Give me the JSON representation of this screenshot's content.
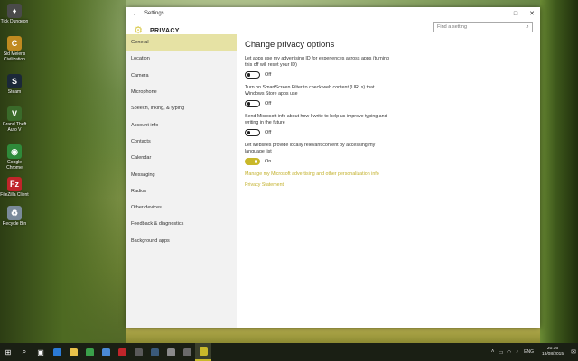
{
  "desktop": {
    "icons": [
      {
        "label": "Recycle Bin",
        "icon": "recycle-bin-icon",
        "color": "#7a8a9a",
        "glyph": "♻"
      },
      {
        "label": "FileZilla Client",
        "icon": "filezilla-icon",
        "color": "#c0252a",
        "glyph": "Fz"
      },
      {
        "label": "Google Chrome",
        "icon": "chrome-icon",
        "color": "#2f8a3a",
        "glyph": "◉"
      },
      {
        "label": "Grand Theft Auto V",
        "icon": "gta-icon",
        "color": "#3a6a2a",
        "glyph": "V"
      },
      {
        "label": "Steam",
        "icon": "steam-icon",
        "color": "#1b2838",
        "glyph": "S"
      },
      {
        "label": "Sid Meier's Civilization",
        "icon": "civ-icon",
        "color": "#c08a20",
        "glyph": "C"
      },
      {
        "label": "Tick Dungeon",
        "icon": "game-icon",
        "color": "#4a4a4a",
        "glyph": "♦"
      }
    ]
  },
  "window": {
    "title": "Settings",
    "back": "←",
    "minimize": "—",
    "maximize": "□",
    "close": "✕",
    "section": "PRIVACY",
    "search_placeholder": "Find a setting",
    "search_icon": "⌕"
  },
  "sidebar": {
    "items": [
      {
        "label": "General",
        "active": true
      },
      {
        "label": "Location",
        "active": false
      },
      {
        "label": "Camera",
        "active": false
      },
      {
        "label": "Microphone",
        "active": false
      },
      {
        "label": "Speech, inking, & typing",
        "active": false
      },
      {
        "label": "Account info",
        "active": false
      },
      {
        "label": "Contacts",
        "active": false
      },
      {
        "label": "Calendar",
        "active": false
      },
      {
        "label": "Messaging",
        "active": false
      },
      {
        "label": "Radios",
        "active": false
      },
      {
        "label": "Other devices",
        "active": false
      },
      {
        "label": "Feedback & diagnostics",
        "active": false
      },
      {
        "label": "Background apps",
        "active": false
      }
    ]
  },
  "content": {
    "title": "Change privacy options",
    "options": [
      {
        "text": "Let apps use my advertising ID for experiences across apps (turning this off will reset your ID)",
        "state": "Off",
        "on": false
      },
      {
        "text": "Turn on SmartScreen Filter to check web content (URLs) that Windows Store apps use",
        "state": "Off",
        "on": false
      },
      {
        "text": "Send Microsoft info about how I write to help us improve typing and writing in the future",
        "state": "Off",
        "on": false
      },
      {
        "text": "Let websites provide locally relevant content by accessing my language list",
        "state": "On",
        "on": true
      }
    ],
    "link_manage": "Manage my Microsoft advertising and other personalization info",
    "link_privacy": "Privacy Statement"
  },
  "taskbar": {
    "start": "⊞",
    "search": "⌕",
    "task_view": "▣",
    "apps": [
      {
        "name": "edge",
        "color": "#2b7bd6",
        "active": false
      },
      {
        "name": "explorer",
        "color": "#e8c24a",
        "active": false
      },
      {
        "name": "chrome",
        "color": "#3aa04a",
        "active": false
      },
      {
        "name": "store",
        "color": "#4a8ad6",
        "active": false
      },
      {
        "name": "filezilla",
        "color": "#c0252a",
        "active": false
      },
      {
        "name": "gta",
        "color": "#5a5a5a",
        "active": false
      },
      {
        "name": "steam",
        "color": "#3a5a7a",
        "active": false
      },
      {
        "name": "app",
        "color": "#8a8a8a",
        "active": false
      },
      {
        "name": "calculator",
        "color": "#6a6a6a",
        "active": false
      },
      {
        "name": "settings",
        "color": "#c9b82a",
        "active": true
      }
    ],
    "tray": {
      "chevron": "˄",
      "battery": "▭",
      "wifi": "◠",
      "volume": "♪",
      "language": "ENG",
      "time": "20:16",
      "date": "18/08/2015",
      "notifications": "✉"
    }
  },
  "colors": {
    "accent": "#c9b82a",
    "active_nav": "#e6e2a4",
    "sidebar_bg": "#f2f2f2"
  }
}
